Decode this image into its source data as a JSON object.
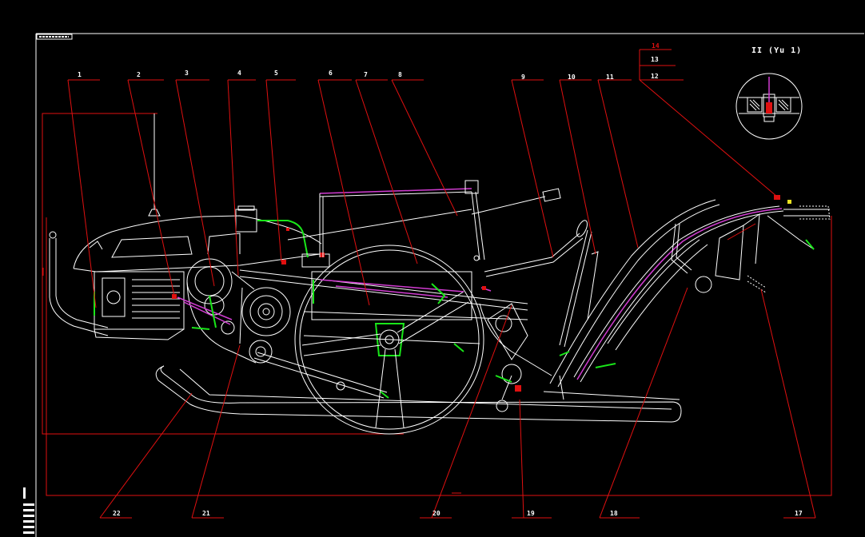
{
  "colors": {
    "background": "#000000",
    "outline": "#ffffff",
    "leader_lines": "#e01010",
    "highlight_green": "#19e619",
    "highlight_magenta": "#d23cd2"
  },
  "labels": {
    "top": [
      "1",
      "2",
      "3",
      "4",
      "5",
      "6",
      "7",
      "8",
      "9",
      "10",
      "11"
    ],
    "table": [
      "14",
      "13",
      "12"
    ],
    "bottom": [
      "22",
      "21",
      "20",
      "19",
      "18",
      "17"
    ]
  },
  "detail_view": {
    "label": "II (Yu 1)"
  }
}
